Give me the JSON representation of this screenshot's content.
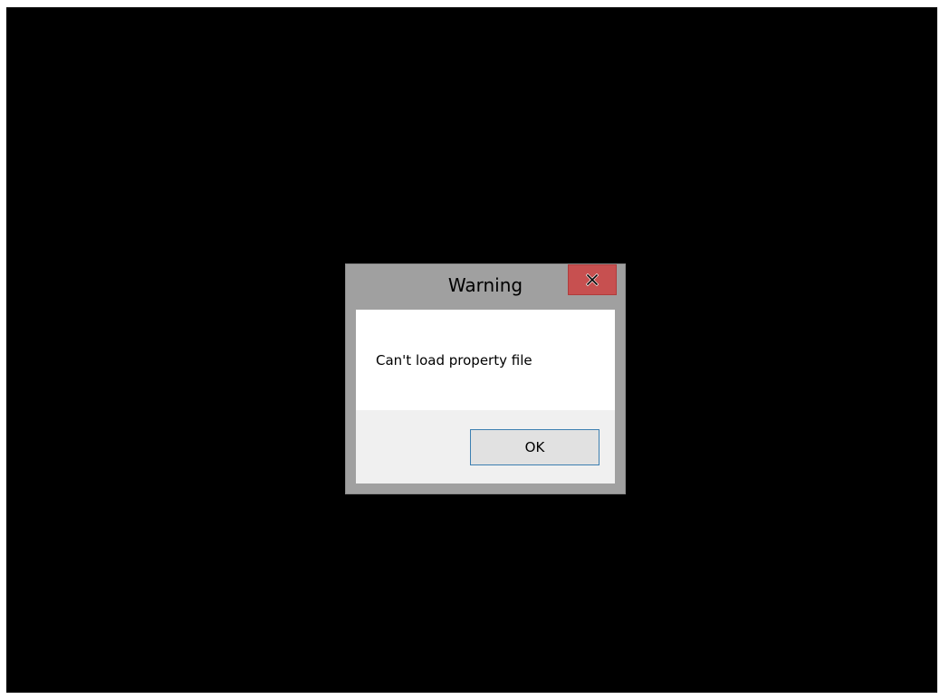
{
  "dialog": {
    "title": "Warning",
    "message": "Can't load property file",
    "ok_label": "OK",
    "close_icon": "close-icon"
  },
  "colors": {
    "desktop_background": "#000000",
    "dialog_frame": "#a0a0a0",
    "close_button": "#c75050",
    "button_strip": "#f0f0f0",
    "ok_button_border": "#3c7fb1"
  }
}
